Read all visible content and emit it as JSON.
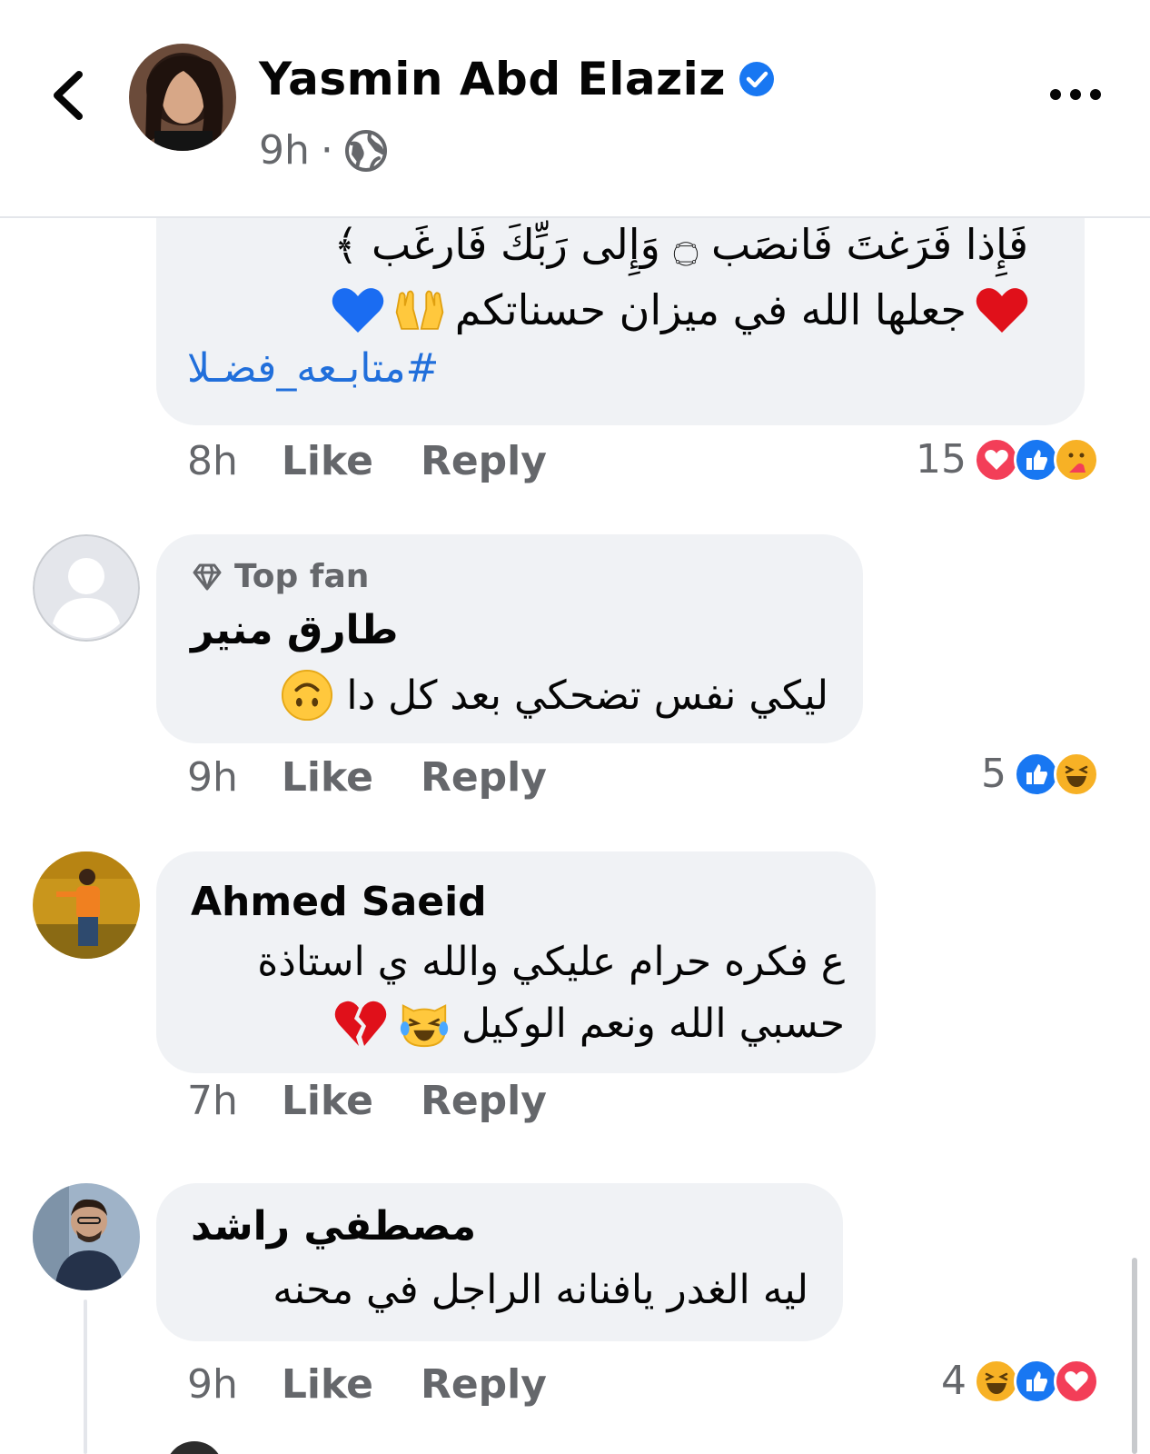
{
  "header": {
    "author_name": "Yasmin Abd Elaziz",
    "time": "9h",
    "separator": "·",
    "icons": [
      "back-icon",
      "verified-icon",
      "globe-icon",
      "more-icon"
    ]
  },
  "comments": [
    {
      "lines": [
        "فَإِذا فَرَغتَ فَانصَب ۝ وَإِلى رَبِّكَ فَارغَب ﴾",
        "جعلها الله في ميزان حسناتكم",
        "#متابـعه_فضـلا"
      ],
      "time": "8h",
      "like": "Like",
      "reply": "Reply",
      "reaction_count": "15",
      "reactions": [
        "love",
        "like",
        "care"
      ]
    },
    {
      "badge": "Top fan",
      "author": "طارق منير",
      "text": "ليكي نفس تضحكي بعد كل دا",
      "time": "9h",
      "like": "Like",
      "reply": "Reply",
      "reaction_count": "5",
      "reactions": [
        "like",
        "haha"
      ]
    },
    {
      "author": "Ahmed Saeid",
      "lines": [
        "ع فكره حرام عليكي والله ي استاذة",
        "حسبي الله ونعم الوكيل"
      ],
      "time": "7h",
      "like": "Like",
      "reply": "Reply"
    },
    {
      "author": "مصطفي راشد",
      "text": "ليه الغدر يافنانه الراجل في محنه",
      "time": "9h",
      "like": "Like",
      "reply": "Reply",
      "reaction_count": "4",
      "reactions": [
        "haha",
        "like",
        "love"
      ]
    }
  ],
  "colors": {
    "bubble": "#f0f2f5",
    "meta": "#65676b",
    "link": "#216fdb",
    "verified": "#1877f2",
    "love": "#f33e58",
    "like": "#1877f2"
  }
}
